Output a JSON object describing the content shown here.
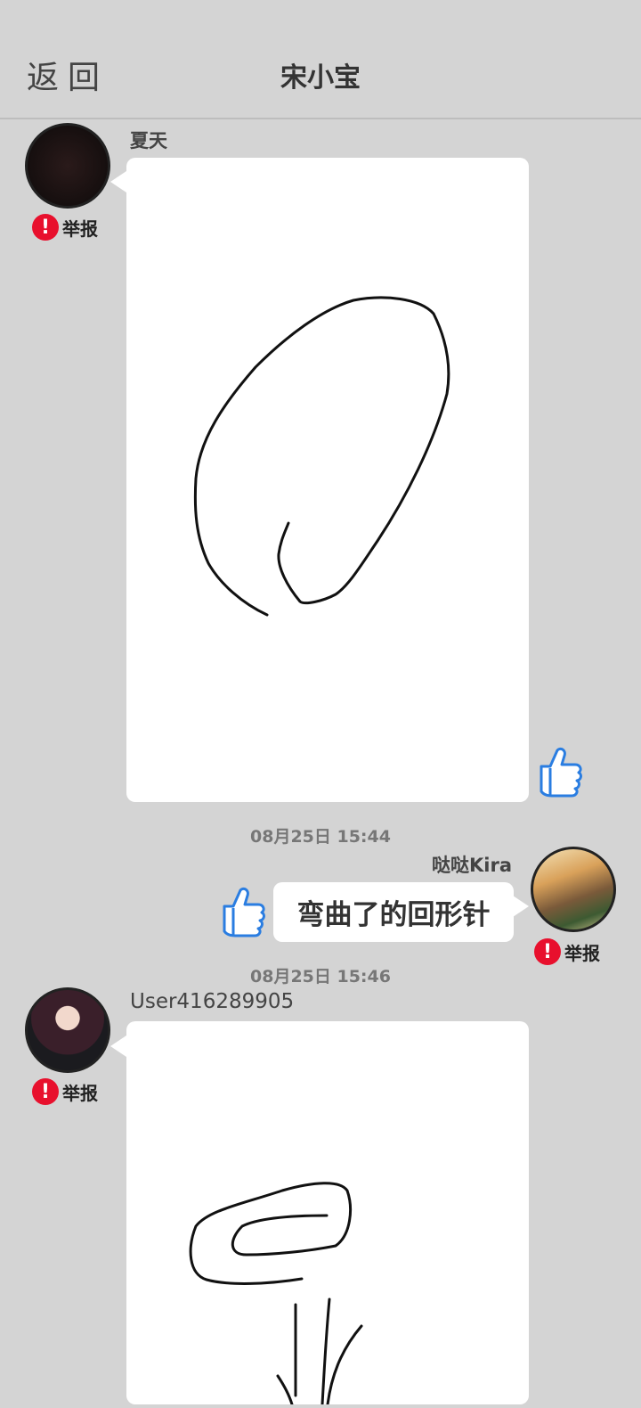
{
  "header": {
    "back_label": "返回",
    "title": "宋小宝"
  },
  "messages": [
    {
      "user": "夏天",
      "report_label": "举报",
      "type": "drawing"
    },
    {
      "time": "08月25日  15:44",
      "user": "哒哒Kira",
      "text": "弯曲了的回形针",
      "report_label": "举报"
    },
    {
      "time": "08月25日  15:46",
      "user": "User416289905",
      "report_label": "举报",
      "type": "drawing"
    }
  ],
  "icons": {
    "like": "thumbs-up-icon",
    "report": "exclamation-icon"
  },
  "colors": {
    "background": "#d4d4d4",
    "report_red": "#e8102d",
    "like_blue": "#2a7de1"
  }
}
